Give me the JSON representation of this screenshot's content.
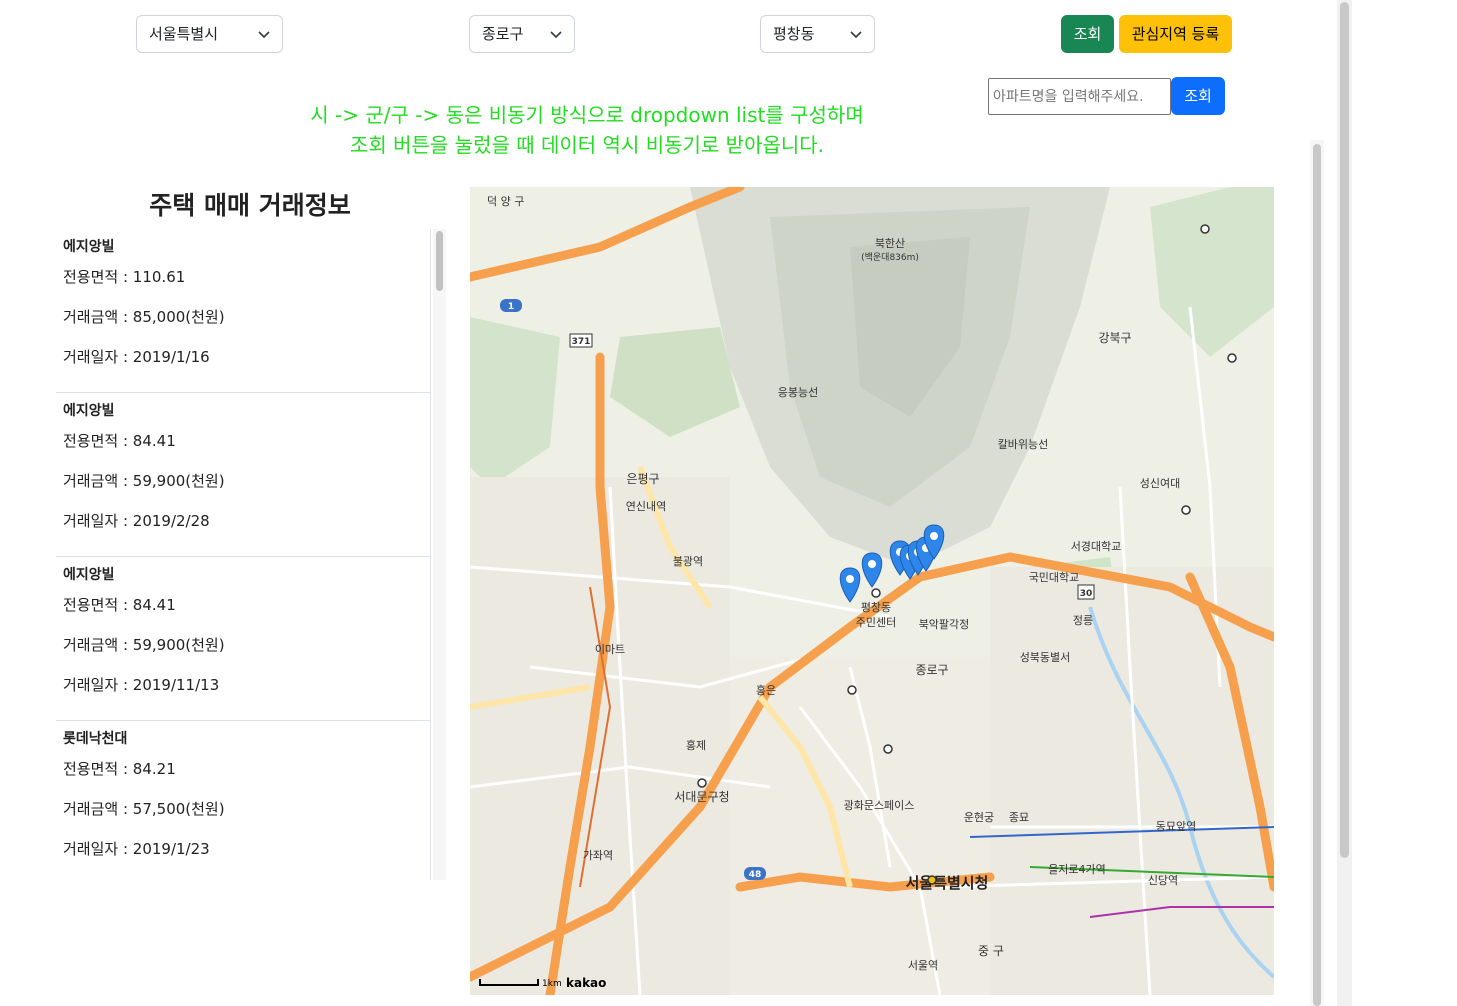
{
  "filters": {
    "city": "서울특별시",
    "district": "종로구",
    "dong": "평창동",
    "search_button": "조회",
    "favorite_button": "관심지역 등록"
  },
  "apartment_search": {
    "placeholder": "아파트명을 입력해주세요.",
    "button": "조회"
  },
  "note": {
    "line1": "시 -> 군/구 -> 동은 비동기 방식으로 dropdown list를 구성하며",
    "line2": "조회 버튼을 눌렀을 때 데이터 역시 비동기로 받아옵니다."
  },
  "panel": {
    "title": "주택 매매 거래정보",
    "items": [
      {
        "name": "에지앙빌",
        "area": "전용면적 : 110.61",
        "price": "거래금액 : 85,000(천원)",
        "date": "거래일자 : 2019/1/16"
      },
      {
        "name": "에지앙빌",
        "area": "전용면적 : 84.41",
        "price": "거래금액 : 59,900(천원)",
        "date": "거래일자 : 2019/2/28"
      },
      {
        "name": "에지앙빌",
        "area": "전용면적 : 84.41",
        "price": "거래금액 : 59,900(천원)",
        "date": "거래일자 : 2019/11/13"
      },
      {
        "name": "롯데낙천대",
        "area": "전용면적 : 84.21",
        "price": "거래금액 : 57,500(천원)",
        "date": "거래일자 : 2019/1/23"
      }
    ]
  },
  "map": {
    "labels": {
      "pyeongchang": "평창동",
      "pyeongchang_center": "주민센터",
      "city_hall": "서울특별시청",
      "jongno": "종로구",
      "eunpyeong": "은평구",
      "gangbuk": "강북구",
      "seodaemun": "서대문구청",
      "bukhansan": "북한산",
      "bukhansan_sub": "(백운대836m)",
      "eungbong": "응봉능선",
      "kalbawi": "칼바위능선",
      "kookmin": "국민대학교",
      "bugak": "북악팔각정",
      "seongbuk": "성북동별서",
      "hongeun": "홍은",
      "hongje": "홍제",
      "gwanghwamun": "광화문스페이스",
      "jongmyo": "종묘",
      "unhyeon": "운현궁",
      "seoul_stn": "서울역",
      "eulji": "을지로4가역",
      "sindang": "신당역",
      "dongdaemun": "동묘앞역",
      "junggu": "중 구",
      "deogyang": "덕 양 구",
      "gajwa": "가좌역",
      "yeonsinnae": "연신내역",
      "bulgwang": "불광역",
      "ipmart": "이마트",
      "sungshin": "성신여대",
      "seogyeong": "서경대학교",
      "jeongneung": "정릉",
      "route_30": "30",
      "route_1": "1",
      "route_371": "371",
      "route_48": "48",
      "scale": "1km",
      "brand": "kakao"
    }
  }
}
